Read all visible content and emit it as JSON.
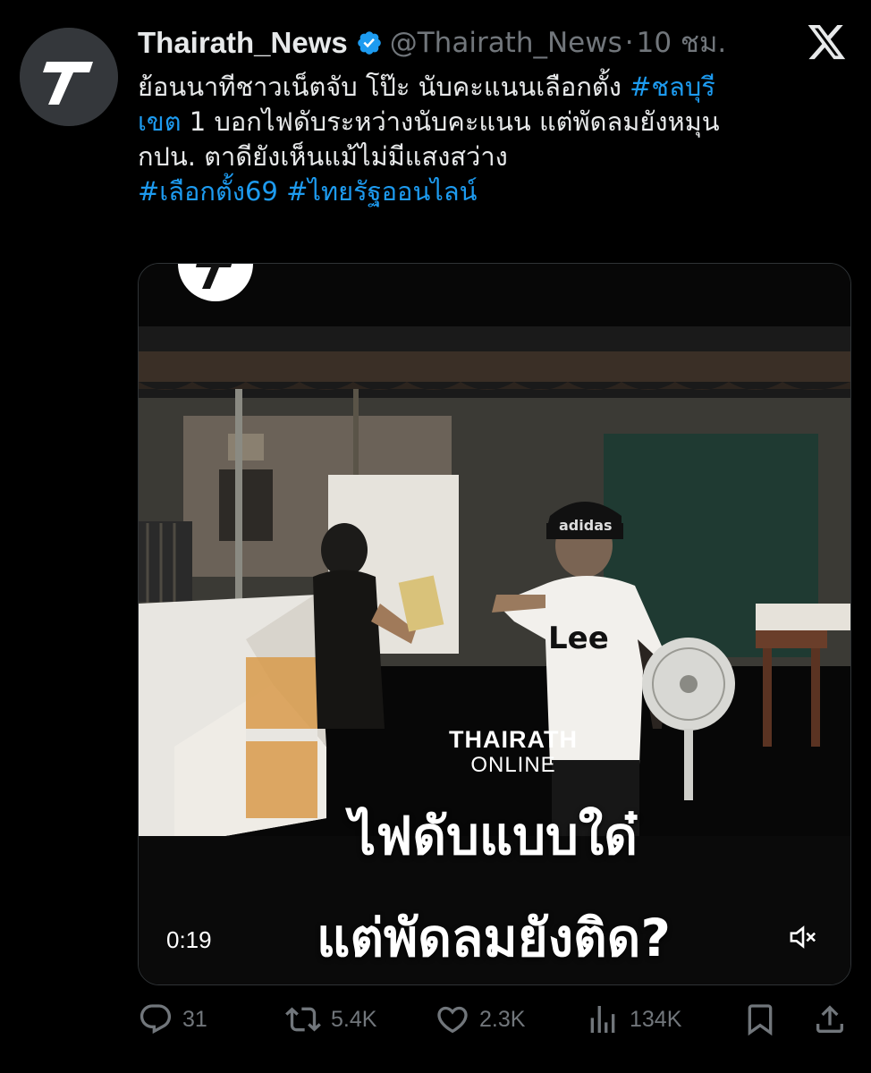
{
  "tweet": {
    "display_name": "Thairath_News",
    "handle": "@Thairath_News",
    "separator": "·",
    "time": "10 ชม.",
    "text_lines": [
      {
        "plain": "ย้อนนาทีชาวเน็ตจับ โป๊ะ นับคะแนนเลือกตั้ง ",
        "tag": "#ชลบุรี"
      },
      {
        "tag": "เขต",
        "plain": " 1 บอกไฟดับระหว่างนับคะแนน แต่พัดลมยังหมุน"
      },
      {
        "plain": "กปน. ตาดียังเห็นแม้ไม่มีแสงสว่าง"
      },
      {
        "tag": "#เลือกตั้ง69 #ไทยรัฐออนไลน์"
      }
    ]
  },
  "video": {
    "watermark_line1": "THAIRATH",
    "watermark_line2": "ONLINE",
    "shirt_text": "Lee",
    "cap_text": "adidas",
    "caption_line1": "ไฟดับแบบใด๋",
    "caption_line2": "แต่พัดลมยังติด?",
    "duration": "0:19"
  },
  "actions": {
    "replies": "31",
    "reposts": "5.4K",
    "likes": "2.3K",
    "views": "134K"
  },
  "icons": {
    "avatar": "thairath-logo-icon",
    "verified": "verified-badge-icon",
    "x_logo": "x-logo-icon",
    "reply": "reply-icon",
    "repost": "repost-icon",
    "like": "heart-icon",
    "views": "views-icon",
    "bookmark": "bookmark-icon",
    "share": "share-icon",
    "mute": "muted-speaker-icon"
  },
  "colors": {
    "background": "#000000",
    "text": "#e7e9ea",
    "secondary": "#71767b",
    "link": "#1d9bf0"
  }
}
